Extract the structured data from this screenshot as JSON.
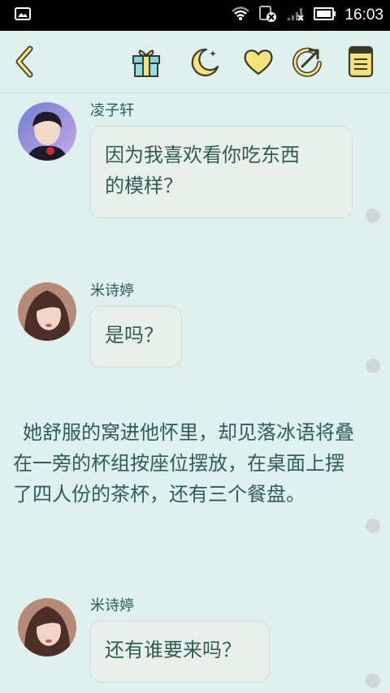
{
  "status_bar": {
    "time": "16:03",
    "icons": [
      "image-icon",
      "wifi-icon",
      "sim-off-icon",
      "signal-icon",
      "battery-icon"
    ]
  },
  "toolbar": {
    "icons": [
      "back-icon",
      "gift-icon",
      "night-mode-icon",
      "heart-icon",
      "share-icon",
      "notes-icon"
    ],
    "accent_color": "#f6e27a",
    "stroke_color": "#3a3a2a"
  },
  "messages": [
    {
      "type": "chat",
      "speaker": "凌子轩",
      "text_lines": [
        "因为我喜欢看你吃东西",
        "的模样？"
      ]
    },
    {
      "type": "chat",
      "speaker": "米诗婷",
      "text_lines": [
        "是吗？"
      ]
    },
    {
      "type": "narration",
      "text": "她舒服的窝进他怀里，却见落冰语将叠在一旁的杯组按座位摆放，在桌面上摆了四人份的茶杯，还有三个餐盘。"
    },
    {
      "type": "chat",
      "speaker": "米诗婷",
      "text_lines": [
        "还有谁要来吗？"
      ]
    }
  ]
}
